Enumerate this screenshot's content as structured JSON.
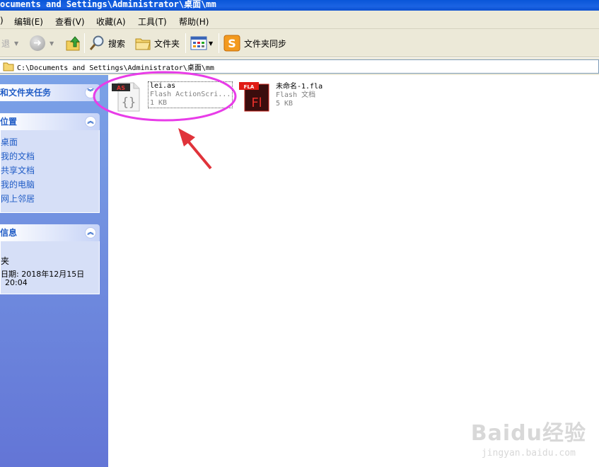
{
  "window": {
    "title": "ocuments and Settings\\Administrator\\桌面\\mm"
  },
  "menu": {
    "items": [
      {
        "label": ")"
      },
      {
        "label": "编辑",
        "key": "(E)"
      },
      {
        "label": "查看",
        "key": "(V)"
      },
      {
        "label": "收藏",
        "key": "(A)"
      },
      {
        "label": "工具",
        "key": "(T)"
      },
      {
        "label": "帮助",
        "key": "(H)"
      }
    ]
  },
  "toolbar": {
    "back_label": "退",
    "search_label": "搜索",
    "folders_label": "文件夹",
    "sync_label": "文件夹同步"
  },
  "address": {
    "path": "C:\\Documents and Settings\\Administrator\\桌面\\mm"
  },
  "sidebar": {
    "tasks_title": "和文件夹任务",
    "places_title": "位置",
    "places": [
      {
        "label": "桌面"
      },
      {
        "label": "我的文档"
      },
      {
        "label": "共享文档"
      },
      {
        "label": "我的电脑"
      },
      {
        "label": "网上邻居"
      }
    ],
    "details_title": "信息",
    "details": {
      "name": "夹",
      "modified_line": "日期: 2018年12月15日",
      "time": "20:04"
    }
  },
  "files": [
    {
      "name": "lei.as",
      "type": "Flash ActionScri...",
      "size": "1 KB",
      "badge": "AS",
      "glyph": "{}",
      "icon": "actionscript-file-icon"
    },
    {
      "name": "未命名-1.fla",
      "type": "Flash 文档",
      "size": "5 KB",
      "badge": "FLA",
      "glyph": "Fl",
      "icon": "flash-document-icon"
    }
  ],
  "watermark": {
    "logo": "Baidu经验",
    "url": "jingyan.baidu.com"
  },
  "colors": {
    "titlebar": "#0a56d8",
    "annotation_circle": "#e83ce8",
    "annotation_arrow": "#e0333a",
    "fla_red": "#c6241c",
    "fla_dark": "#3a0d0d",
    "link_blue": "#215dc6"
  }
}
